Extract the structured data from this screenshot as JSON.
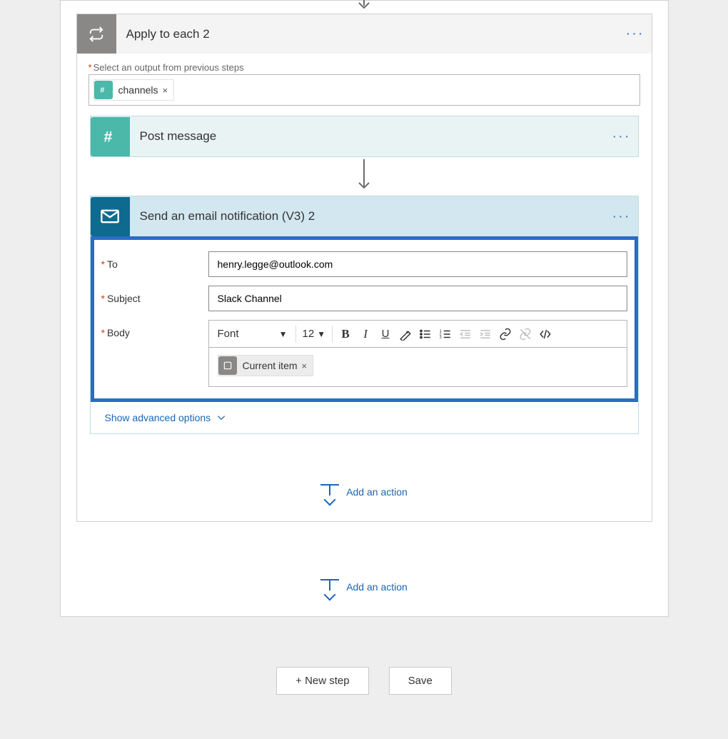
{
  "flow": {
    "applyToEach": {
      "title": "Apply to each 2",
      "selectOutputLabel": "Select an output from previous steps",
      "token": {
        "label": "channels"
      }
    },
    "postMessage": {
      "title": "Post message"
    },
    "email": {
      "title": "Send an email notification (V3) 2",
      "fields": {
        "toLabel": "To",
        "toValue": "henry.legge@outlook.com",
        "subjectLabel": "Subject",
        "subjectValue": "Slack Channel",
        "bodyLabel": "Body",
        "bodyToken": "Current item",
        "toolbar": {
          "fontLabel": "Font",
          "size": "12"
        }
      },
      "advancedLink": "Show advanced options"
    },
    "addActionLabel": "Add an action"
  },
  "footer": {
    "newStep": "+ New step",
    "save": "Save"
  }
}
